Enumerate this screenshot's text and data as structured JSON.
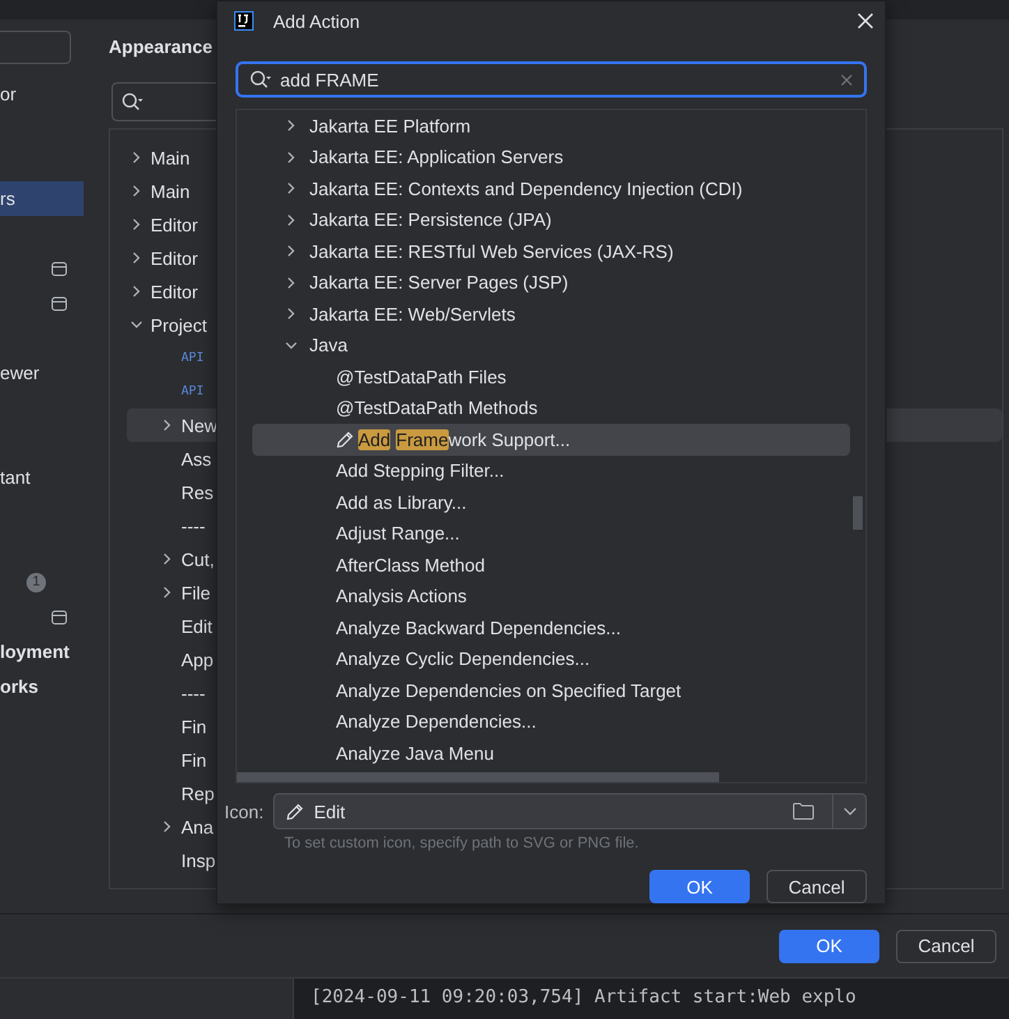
{
  "settings": {
    "header": "Appearance",
    "sidebar": [
      {
        "label": "or",
        "selected": false,
        "kind": "text"
      },
      {
        "label": "rs",
        "selected": true,
        "kind": "text"
      },
      {
        "kind": "window-icon",
        "selected": false
      },
      {
        "kind": "window-icon",
        "selected": false
      },
      {
        "label": "ewer",
        "selected": false,
        "kind": "text"
      },
      {
        "label": "tant",
        "selected": false,
        "kind": "text"
      },
      {
        "label": "1",
        "kind": "badge",
        "selected": false
      },
      {
        "kind": "window-icon",
        "selected": false
      },
      {
        "label": "loyment",
        "selected": false,
        "kind": "bold"
      },
      {
        "label": "orks",
        "selected": false,
        "kind": "bold"
      }
    ],
    "tree": [
      {
        "label": "Main",
        "expanded": false
      },
      {
        "label": "Main",
        "expanded": false
      },
      {
        "label": "Editor",
        "expanded": false
      },
      {
        "label": "Editor",
        "expanded": false
      },
      {
        "label": "Editor",
        "expanded": false
      },
      {
        "label": "Project",
        "expanded": true,
        "children": [
          {
            "badge": "API"
          },
          {
            "badge": "API"
          },
          {
            "label": "New",
            "expanded": false,
            "selected": true
          },
          {
            "label": "Ass"
          },
          {
            "label": "Res"
          },
          {
            "label": "----"
          },
          {
            "label": "Cut,",
            "expanded": false
          },
          {
            "label": "File",
            "expanded": false
          },
          {
            "label": "Edit"
          },
          {
            "label": "App"
          },
          {
            "label": "----"
          },
          {
            "label": "Fin"
          },
          {
            "label": "Fin"
          },
          {
            "label": "Rep"
          },
          {
            "label": "Ana",
            "expanded": false
          },
          {
            "label": "Insp"
          }
        ]
      }
    ],
    "buttons": [
      {
        "label": "OK",
        "kind": "primary"
      },
      {
        "label": "Cancel",
        "kind": "secondary"
      }
    ]
  },
  "log": {
    "line": "[2024-09-11 09:20:03,754] Artifact start:Web explo"
  },
  "dialog": {
    "title": "Add Action",
    "search": {
      "value": "add FRAME"
    },
    "actions": [
      {
        "label": "Jakarta EE Platform",
        "expanded": false
      },
      {
        "label": "Jakarta EE: Application Servers",
        "expanded": false
      },
      {
        "label": "Jakarta EE: Contexts and Dependency Injection (CDI)",
        "expanded": false
      },
      {
        "label": "Jakarta EE: Persistence (JPA)",
        "expanded": false
      },
      {
        "label": "Jakarta EE: RESTful Web Services (JAX-RS)",
        "expanded": false
      },
      {
        "label": "Jakarta EE: Server Pages (JSP)",
        "expanded": false
      },
      {
        "label": "Jakarta EE: Web/Servlets",
        "expanded": false
      },
      {
        "label": "Java",
        "expanded": true,
        "children": [
          {
            "parts": [
              {
                "text": "@TestDataPath Files",
                "match": false
              }
            ],
            "selected": false,
            "icon": false
          },
          {
            "parts": [
              {
                "text": "@TestDataPath Methods",
                "match": false
              }
            ],
            "selected": false,
            "icon": false
          },
          {
            "parts": [
              {
                "text": "Add",
                "match": true
              },
              {
                "text": "Frame",
                "match": true
              },
              {
                "text": "work Support...",
                "match": false
              }
            ],
            "selected": true,
            "icon": true
          },
          {
            "parts": [
              {
                "text": "Add Stepping Filter...",
                "match": false
              }
            ],
            "selected": false,
            "icon": false
          },
          {
            "parts": [
              {
                "text": "Add as Library...",
                "match": false
              }
            ],
            "selected": false,
            "icon": false
          },
          {
            "parts": [
              {
                "text": "Adjust Range...",
                "match": false
              }
            ],
            "selected": false,
            "icon": false
          },
          {
            "parts": [
              {
                "text": "AfterClass Method",
                "match": false
              }
            ],
            "selected": false,
            "icon": false
          },
          {
            "parts": [
              {
                "text": "Analysis Actions",
                "match": false
              }
            ],
            "selected": false,
            "icon": false
          },
          {
            "parts": [
              {
                "text": "Analyze Backward Dependencies...",
                "match": false
              }
            ],
            "selected": false,
            "icon": false
          },
          {
            "parts": [
              {
                "text": "Analyze Cyclic Dependencies...",
                "match": false
              }
            ],
            "selected": false,
            "icon": false
          },
          {
            "parts": [
              {
                "text": "Analyze Dependencies on Specified Target",
                "match": false
              }
            ],
            "selected": false,
            "icon": false
          },
          {
            "parts": [
              {
                "text": "Analyze Dependencies...",
                "match": false
              }
            ],
            "selected": false,
            "icon": false
          },
          {
            "parts": [
              {
                "text": "Analyze Java Menu",
                "match": false
              }
            ],
            "selected": false,
            "icon": false
          }
        ]
      }
    ],
    "icon_field": {
      "label": "Icon:",
      "value": "Edit",
      "hint": "To set custom icon, specify path to SVG or PNG file."
    },
    "buttons": [
      {
        "label": "OK",
        "kind": "primary"
      },
      {
        "label": "Cancel",
        "kind": "secondary"
      }
    ]
  }
}
